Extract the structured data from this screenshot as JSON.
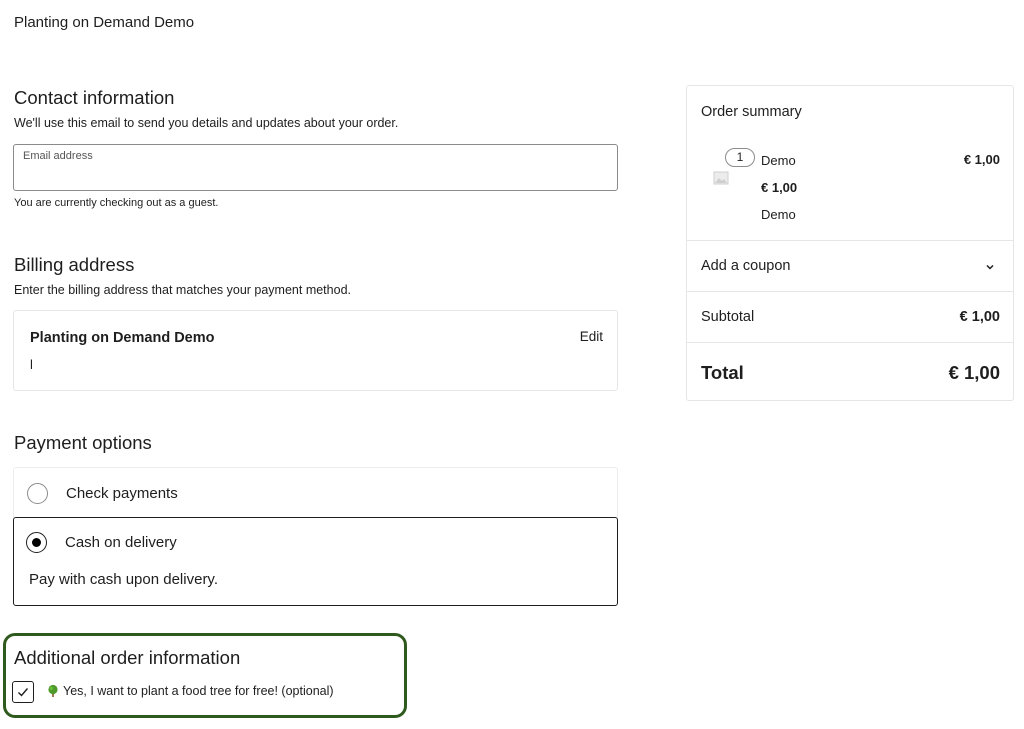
{
  "site": {
    "title": "Planting on Demand Demo"
  },
  "contact": {
    "heading": "Contact information",
    "description": "We'll use this email to send you details and updates about your order.",
    "email_label": "Email address",
    "guest_note": "You are currently checking out as a guest."
  },
  "billing": {
    "heading": "Billing address",
    "description": "Enter the billing address that matches your payment method.",
    "name": "Planting on Demand Demo",
    "address": "l",
    "edit_label": "Edit"
  },
  "payment": {
    "heading": "Payment options",
    "options": [
      {
        "label": "Check payments",
        "selected": false
      },
      {
        "label": "Cash on delivery",
        "selected": true,
        "description": "Pay with cash upon delivery."
      }
    ]
  },
  "additional": {
    "heading": "Additional order information",
    "tree_checkbox_label": "Yes, I want to plant a food tree for free! (optional)",
    "tree_checkbox_checked": true,
    "highlight_color": "#2f5a1e"
  },
  "summary": {
    "heading": "Order summary",
    "item": {
      "quantity": "1",
      "name": "Demo",
      "price": "€ 1,00",
      "description": "Demo",
      "total": "€ 1,00"
    },
    "coupon_label": "Add a coupon",
    "subtotal_label": "Subtotal",
    "subtotal_value": "€ 1,00",
    "total_label": "Total",
    "total_value": "€ 1,00"
  }
}
